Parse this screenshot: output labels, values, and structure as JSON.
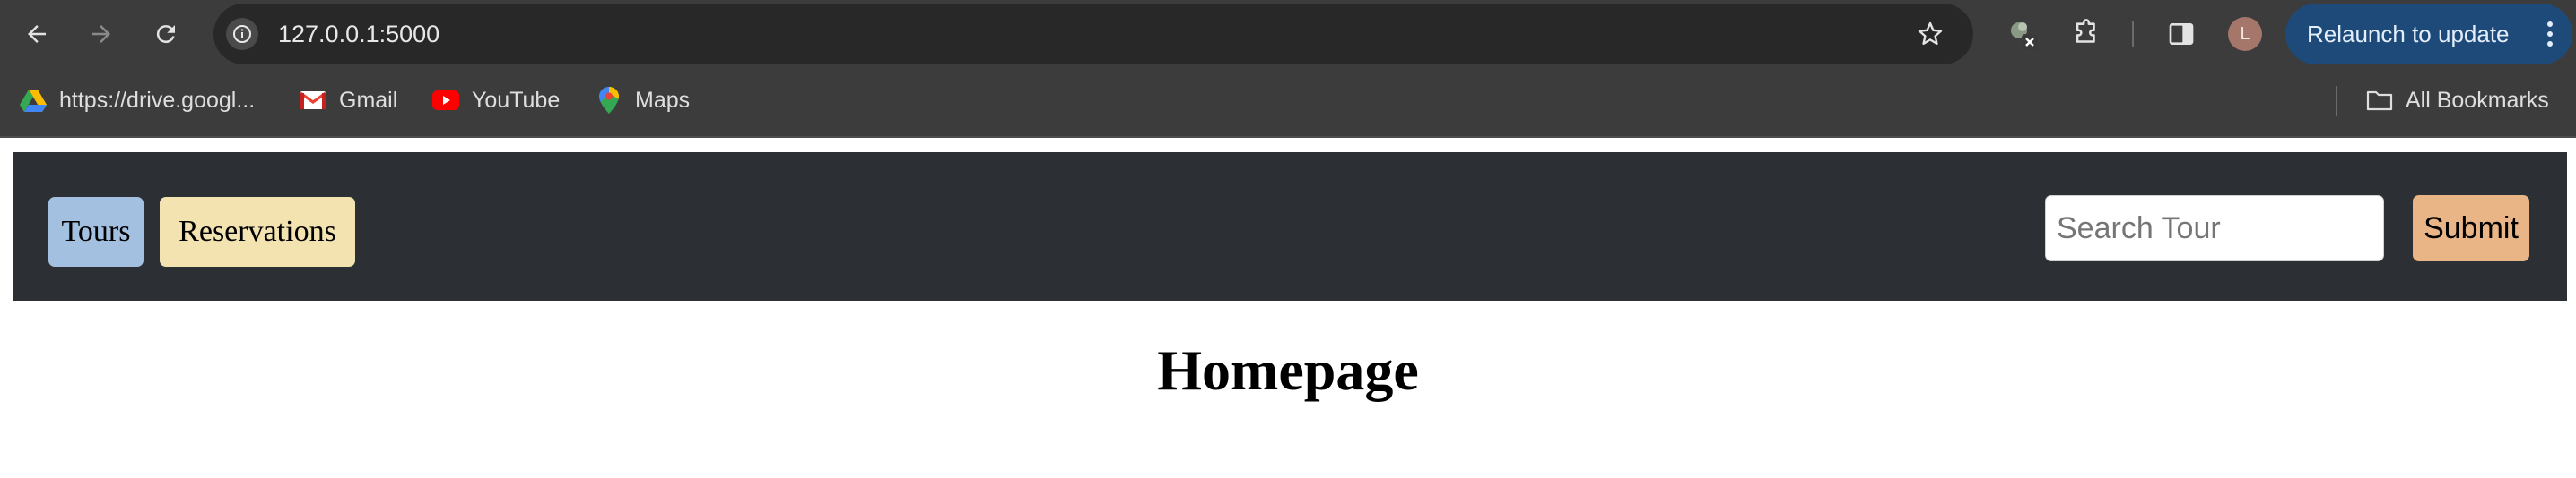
{
  "browser": {
    "url": "127.0.0.1:5000",
    "relaunch_label": "Relaunch to update",
    "profile_initial": "L",
    "icons": {
      "back": "arrow-left-icon",
      "forward": "arrow-right-icon",
      "reload": "reload-icon",
      "site_info": "info-icon",
      "bookmark_star": "star-icon",
      "extension_badge": "extension-x-icon",
      "extensions": "puzzle-icon",
      "side_panel": "side-panel-icon",
      "menu": "kebab-menu-icon"
    },
    "bookmarks": [
      {
        "label": "https://drive.googl...",
        "icon": "google-drive-icon"
      },
      {
        "label": "Gmail",
        "icon": "gmail-icon"
      },
      {
        "label": "YouTube",
        "icon": "youtube-icon"
      },
      {
        "label": "Maps",
        "icon": "google-maps-icon"
      }
    ],
    "all_bookmarks_label": "All Bookmarks"
  },
  "site": {
    "nav": {
      "tours_label": "Tours",
      "reservations_label": "Reservations"
    },
    "search": {
      "placeholder": "Search Tour",
      "value": "",
      "submit_label": "Submit"
    },
    "title": "Homepage"
  },
  "colors": {
    "browser_bg": "#3c3c3c",
    "omnibox_bg": "#282828",
    "relaunch_bg": "#1e4a7a",
    "navbar_bg": "#2c3034",
    "tours_button": "#a3c0e0",
    "reservations_button": "#f2e3b1",
    "submit_button": "#e9b586"
  }
}
